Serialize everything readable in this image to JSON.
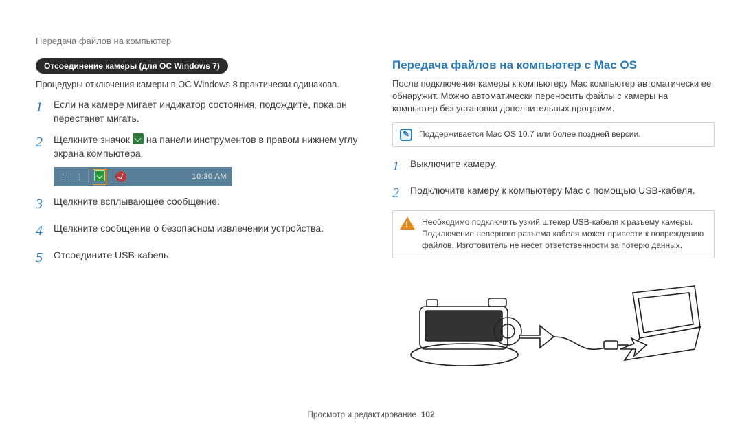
{
  "header": {
    "title": "Передача файлов на компьютер"
  },
  "left": {
    "pill": "Отсоединение камеры (для ОС Windows 7)",
    "intro": "Процедуры отключения камеры в ОС Windows 8 практически одинакова.",
    "step1": "Если на камере мигает индикатор состояния, подождите, пока он перестанет мигать.",
    "step2a": "Щелкните значок ",
    "step2b": " на панели инструментов в правом нижнем углу экрана компьютера.",
    "taskbar_time": "10:30 AM",
    "step3": "Щелкните всплывающее сообщение.",
    "step4": "Щелкните сообщение о безопасном извлечении устройства.",
    "step5": "Отсоедините USB-кабель."
  },
  "right": {
    "section_title": "Передача файлов на компьютер с Mac OS",
    "intro": "После подключения камеры к компьютеру Mac компьютер автоматически ее обнаружит. Можно автоматически переносить файлы с камеры на компьютер без установки дополнительных программ.",
    "note": "Поддерживается Mac OS 10.7 или более поздней версии.",
    "step1": "Выключите камеру.",
    "step2": "Подключите камеру к компьютеру Mac с помощью USB-кабеля.",
    "warn": "Необходимо подключить узкий штекер USB-кабеля к разъему камеры. Подключение неверного разъема кабеля может привести к повреждению файлов. Изготовитель не несет ответственности за потерю данных."
  },
  "footer": {
    "label": "Просмотр и редактирование",
    "page": "102"
  }
}
